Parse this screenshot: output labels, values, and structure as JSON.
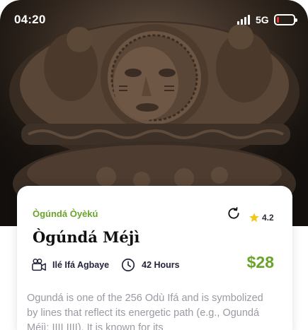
{
  "status_bar": {
    "time": "04:20",
    "network": "5G",
    "battery_level": 0.15,
    "battery_color": "#e53935"
  },
  "hero": {
    "image_icon": "carved-wooden-bowl-photo"
  },
  "card": {
    "category": "Ògúndá Òyèkú",
    "rating": "4.2",
    "title": "Ògúndá Méjì",
    "location_icon": "video-camera-icon",
    "location": "Ilé Ifá Agbaye",
    "duration_icon": "clock-icon",
    "duration": "42 Hours",
    "price": "$28",
    "description": "Ogundá is one of the 256 Odù Ifá and is symbolized by lines that reflect its energetic path (e.g., Ogundá Méjì: IIII IIII). It is known for its",
    "accent_color": "#6aa329"
  }
}
